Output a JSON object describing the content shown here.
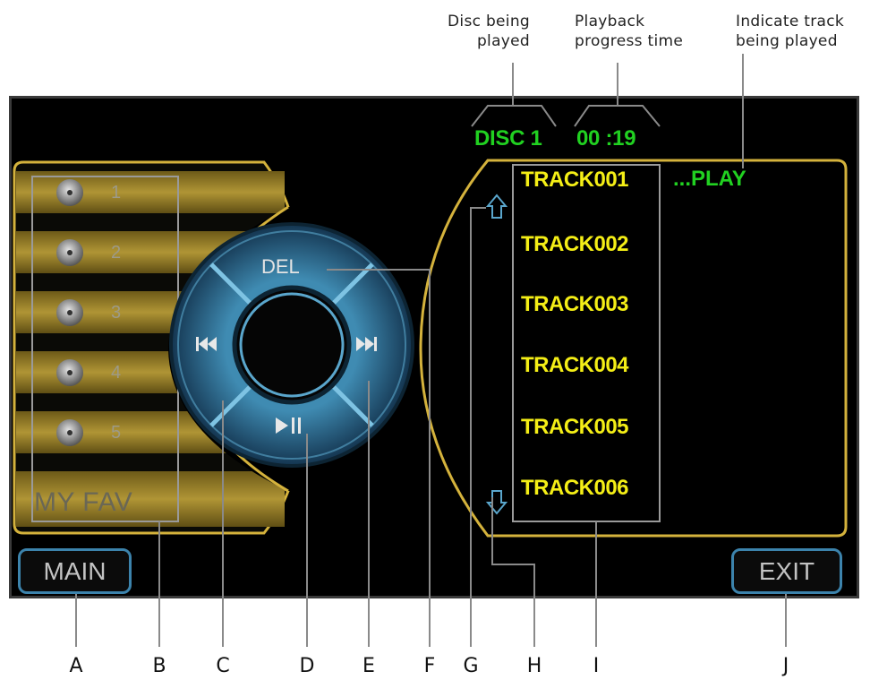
{
  "callouts": {
    "disc": [
      "Disc being",
      "played"
    ],
    "progress": [
      "Playback",
      "progress time"
    ],
    "track": [
      "Indicate track",
      "being played"
    ]
  },
  "screen": {
    "disc": "DISC 1",
    "time": "00 :19",
    "play_status": "...PLAY",
    "favorites": [
      "1",
      "2",
      "3",
      "4",
      "5"
    ],
    "fav_label": "MY FAV",
    "del_label": "DEL",
    "main_button": "MAIN",
    "exit_button": "EXIT",
    "tracks": [
      "TRACK001",
      "TRACK002",
      "TRACK003",
      "TRACK004",
      "TRACK005",
      "TRACK006"
    ]
  },
  "letters": [
    "A",
    "B",
    "C",
    "D",
    "E",
    "F",
    "G",
    "H",
    "I",
    "J"
  ],
  "colors": {
    "status_green": "#21d121",
    "track_yellow": "#f4ee16",
    "gold_frame": "#d4b23c",
    "blue_control": "#3f8bb2"
  }
}
